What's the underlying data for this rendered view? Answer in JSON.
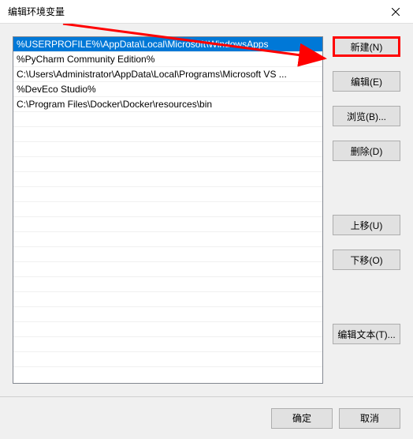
{
  "title": "编辑环境变量",
  "list": {
    "items": [
      "%USERPROFILE%\\AppData\\Local\\Microsoft\\WindowsApps",
      "%PyCharm Community Edition%",
      "C:\\Users\\Administrator\\AppData\\Local\\Programs\\Microsoft VS ...",
      "%DevEco Studio%",
      "C:\\Program Files\\Docker\\Docker\\resources\\bin"
    ],
    "selectedIndex": 0
  },
  "buttons": {
    "new": "新建(N)",
    "edit": "编辑(E)",
    "browse": "浏览(B)...",
    "delete": "删除(D)",
    "moveUp": "上移(U)",
    "moveDown": "下移(O)",
    "editText": "编辑文本(T)..."
  },
  "footer": {
    "ok": "确定",
    "cancel": "取消"
  }
}
